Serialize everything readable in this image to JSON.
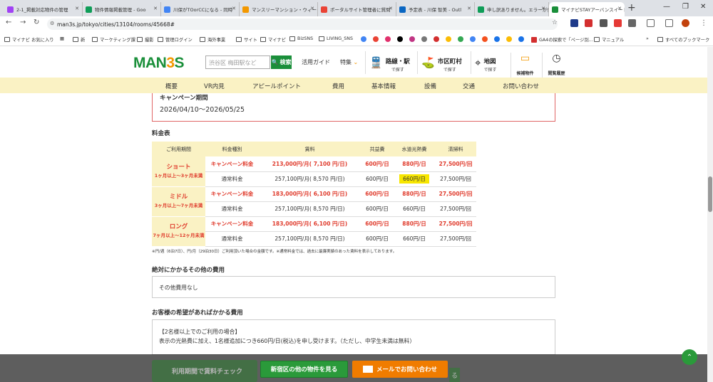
{
  "browser": {
    "tabs": [
      {
        "title": "2-1_掲載対応物件の管理",
        "color": "#a142f4"
      },
      {
        "title": "物件情報掲載管理 - Goo",
        "color": "#0f9d58"
      },
      {
        "title": "川保がTOorCCになる - 同時",
        "color": "#4285f4"
      },
      {
        "title": "マンスリーマンション・ウィークリ",
        "color": "#f39800"
      },
      {
        "title": "ポータルサイト管理者に質問",
        "color": "#ea4335"
      },
      {
        "title": "予定表 - 川保 智美 - Outl",
        "color": "#0a66c2"
      },
      {
        "title": "申し訳ありません。エラーが発",
        "color": "#0f9d58"
      },
      {
        "title": "マイナビSTAYアーバンスイート",
        "color": "#1a8f3a"
      }
    ],
    "url": "man3s.jp/tokyo/cities/13104/rooms/45668#",
    "bookmarks": [
      "マイナビ お気に入り",
      "新",
      "マーケティング課",
      "撮影",
      "管理ログイン",
      "海外事業",
      "サイト",
      "マイナビ",
      "BizSNS",
      "LIVING_SNS",
      "GA4の探索で「ページ別...",
      "マニュアル",
      "すべてのブックマーク"
    ]
  },
  "header": {
    "logo_main": "MAN",
    "logo_three": "3",
    "logo_s": "S",
    "search_placeholder": "渋谷区 梅田駅など",
    "search_button": "検索",
    "guide": "活用ガイド",
    "feature": "特集",
    "nav_line": {
      "title": "路線・駅",
      "sub": "で探す"
    },
    "nav_city": {
      "title": "市区町村",
      "sub": "で探す"
    },
    "nav_map": {
      "title": "地図",
      "sub": "で探す"
    },
    "candidates": "候補物件",
    "history": "閲覧履歴"
  },
  "subnav": [
    "概要",
    "VR内見",
    "アピールポイント",
    "費用",
    "基本情報",
    "設備",
    "交通",
    "お問い合わせ"
  ],
  "campaign": {
    "title": "キャンペーン期間",
    "date": "2026/04/10〜2026/05/25"
  },
  "fee": {
    "title": "料金表",
    "headers": [
      "ご利用期間",
      "料金種別",
      "賃料",
      "共益費",
      "水道光熱費",
      "清掃料"
    ],
    "groups": [
      {
        "name": "ショート",
        "range": "1ヶ月以上〜3ヶ月未満",
        "campaign": [
          "キャンペーン料金",
          "213,000円/月( 7,100 円/日)",
          "600円/日",
          "880円/日",
          "27,500円/回"
        ],
        "normal": [
          "通常料金",
          "257,100円/月( 8,570 円/日)",
          "600円/日",
          "660円/日",
          "27,500円/回"
        ]
      },
      {
        "name": "ミドル",
        "range": "3ヶ月以上〜7ヶ月未満",
        "campaign": [
          "キャンペーン料金",
          "183,000円/月( 6,100 円/日)",
          "600円/日",
          "880円/日",
          "27,500円/回"
        ],
        "normal": [
          "通常料金",
          "257,100円/月( 8,570 円/日)",
          "600円/日",
          "660円/日",
          "27,500円/回"
        ]
      },
      {
        "name": "ロング",
        "range": "7ヶ月以上〜12ヶ月未満",
        "campaign": [
          "キャンペーン料金",
          "183,000円/月( 6,100 円/日)",
          "600円/日",
          "880円/日",
          "27,500円/回"
        ],
        "normal": [
          "通常料金",
          "257,100円/月( 8,570 円/日)",
          "600円/日",
          "660円/日",
          "27,500円/回"
        ]
      }
    ],
    "note": "※円/週（6泊7日）、円/月（29泊30日）ご利用頂いた場合の金額です。※通常料金では、過去に最廉実績のあった賃料を表示しております。"
  },
  "other_fees": {
    "title": "絶対にかかるその他の費用",
    "body": "その他費用なし"
  },
  "optional_fees": {
    "title": "お客様の希望があればかかる費用",
    "line1": "【2名様以上でのご利用の場合】",
    "line2": "表示の光熱費に加え、1名様追加につき660円/日(税込)を申し受けます。（ただし、中学生未満は無料）"
  },
  "bottom": {
    "check": "利用期間で賃料チェック",
    "other": "新宿区の他の物件を見る",
    "mail": "メールでお問い合わせ"
  }
}
